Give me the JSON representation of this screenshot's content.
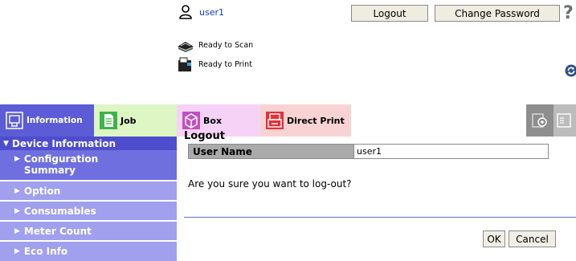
{
  "header": {
    "user_name": "user1",
    "logout_label": "Logout",
    "change_password_label": "Change Password",
    "help_label": "?",
    "scan_status": "Ready to Scan",
    "print_status": "Ready to Print"
  },
  "tabs": {
    "information": "Information",
    "job": "Job",
    "box": "Box",
    "direct_print": "Direct Print"
  },
  "sidebar": {
    "heading": "Device Information",
    "items": [
      {
        "label": "Configuration Summary",
        "active": true
      },
      {
        "label": "Option"
      },
      {
        "label": "Consumables"
      },
      {
        "label": "Meter Count"
      },
      {
        "label": "Eco Info"
      }
    ]
  },
  "main": {
    "title": "Logout",
    "user_name_label": "User Name",
    "user_name_value": "user1",
    "question": "Are you sure you want to log-out?",
    "ok_label": "OK",
    "cancel_label": "Cancel"
  },
  "colors": {
    "info_tab": "#5c5cd6",
    "job_tab": "#ddf6c4",
    "box_tab": "#f6d3f6",
    "direct_print_tab": "#f8d3d3",
    "sidebar_head": "#4d4dce",
    "sidebar_active": "#6f6fe0",
    "sidebar_item": "#a0a0ee"
  },
  "icons": {
    "user": "user-icon",
    "scanner": "scanner-icon",
    "printer": "printer-icon",
    "refresh": "refresh-icon",
    "information": "information-icon",
    "job": "job-icon",
    "box": "box-icon",
    "direct_print": "direct-print-icon",
    "admin": "admin-settings-icon",
    "extension": "extension-icon"
  }
}
